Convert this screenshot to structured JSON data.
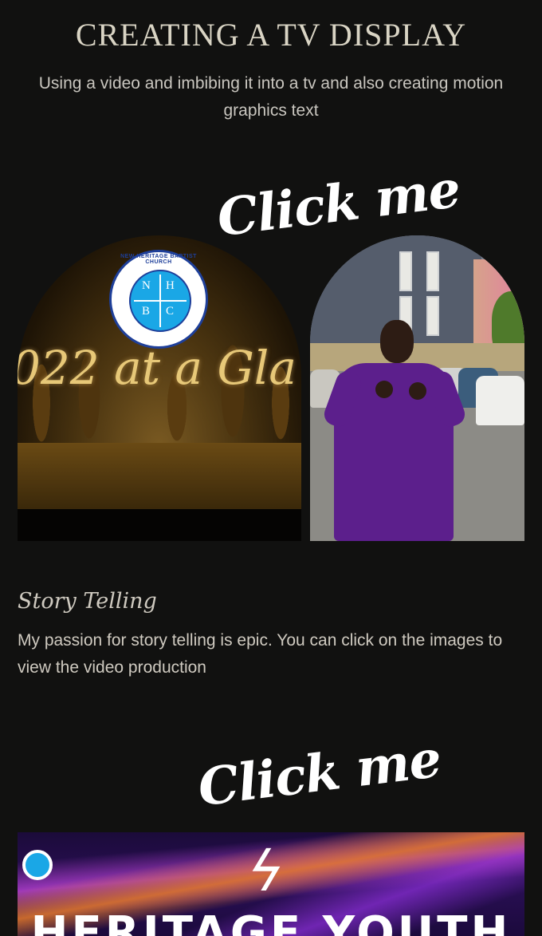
{
  "header": {
    "title": "CREATING A TV DISPLAY",
    "subtitle": "Using a video and imbibing it into a tv and also creating motion graphics text"
  },
  "cta": {
    "first": "Click me",
    "second": "Click me"
  },
  "gallery": {
    "left_image": {
      "overlay_text": "022 at a Gla",
      "logo": {
        "ring_text": "NEW HERITAGE BAPTIST CHURCH",
        "letters": [
          "N",
          "H",
          "B",
          "C"
        ]
      }
    }
  },
  "story": {
    "title": "Story Telling",
    "text": "My passion for story telling is epic. You can click on the images to view the video production"
  },
  "banner": {
    "heading": "HERITAGE YOUTH"
  },
  "colors": {
    "background": "#111110",
    "text": "#cfcac0",
    "purple": "#5c1f8c",
    "gold": "#e7c878",
    "logo_blue": "#1aa7e6"
  },
  "icons": {
    "bolt": "lightning-bolt-icon"
  }
}
